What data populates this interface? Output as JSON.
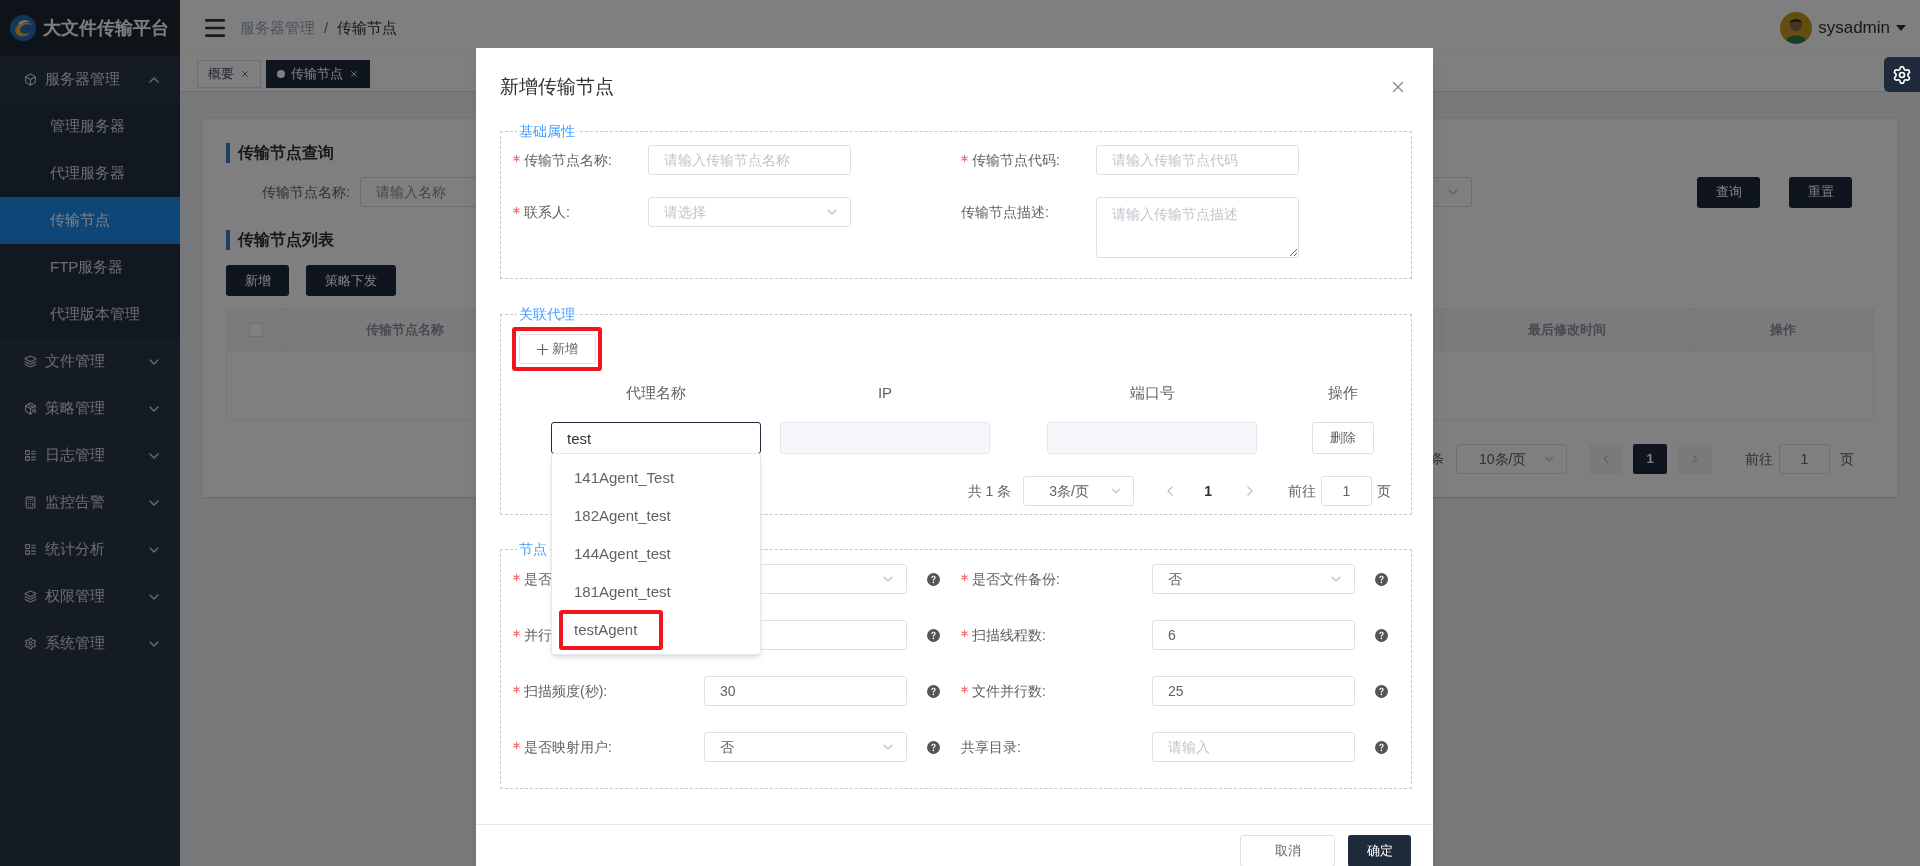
{
  "header": {
    "app_title": "大文件传输平台",
    "breadcrumb": [
      "服务器管理",
      "传输节点"
    ],
    "breadcrumb_separator": "/",
    "user": "sysadmin"
  },
  "sidebar": {
    "items": [
      {
        "label": "服务器管理",
        "expanded": true,
        "children": [
          {
            "label": "管理服务器",
            "selected": false
          },
          {
            "label": "代理服务器",
            "selected": false
          },
          {
            "label": "传输节点",
            "selected": true
          },
          {
            "label": "FTP服务器",
            "selected": false
          },
          {
            "label": "代理版本管理",
            "selected": false
          }
        ]
      },
      {
        "label": "文件管理",
        "expanded": false
      },
      {
        "label": "策略管理",
        "expanded": false
      },
      {
        "label": "日志管理",
        "expanded": false
      },
      {
        "label": "监控告警",
        "expanded": false
      },
      {
        "label": "统计分析",
        "expanded": false
      },
      {
        "label": "权限管理",
        "expanded": false
      },
      {
        "label": "系统管理",
        "expanded": false
      }
    ]
  },
  "tabs": [
    {
      "label": "概要",
      "selected": false
    },
    {
      "label": "传输节点",
      "selected": true
    }
  ],
  "page": {
    "query_title": "传输节点查询",
    "filter": {
      "label": "传输节点名称:",
      "placeholder": "请输入名称"
    },
    "buttons": [
      "查询",
      "重置"
    ],
    "list_title": "传输节点列表",
    "list_buttons": [
      "新增",
      "策略下发"
    ],
    "table": {
      "select_all": {
        "checked": false
      },
      "columns": [
        "传输节点名称",
        "最后修改时间",
        "操作"
      ]
    },
    "pagination": {
      "total_tail": "条",
      "page_size": "10条/页",
      "pages": [
        {
          "label": "1",
          "selected": true
        }
      ],
      "goto_label": "前往",
      "goto_value": "1",
      "goto_suffix": "页"
    }
  },
  "dialog": {
    "title": "新增传输节点",
    "basic": {
      "legend": "基础属性",
      "fields": [
        {
          "label": "传输节点名称:",
          "required": true,
          "kind": "input",
          "placeholder": "请输入传输节点名称"
        },
        {
          "label": "传输节点代码:",
          "required": true,
          "kind": "input",
          "placeholder": "请输入传输节点代码"
        },
        {
          "label": "联系人:",
          "required": true,
          "kind": "select",
          "placeholder": "请选择"
        },
        {
          "label": "传输节点描述:",
          "required": false,
          "kind": "textarea",
          "placeholder": "请输入传输节点描述"
        }
      ]
    },
    "agents": {
      "legend": "关联代理",
      "add_button": {
        "label": "新增",
        "highlighted": true
      },
      "columns": [
        "代理名称",
        "IP",
        "端口号",
        "操作"
      ],
      "rows": [
        {
          "name": "test",
          "delete": "删除"
        }
      ],
      "suggestions": [
        {
          "label": "141Agent_Test",
          "highlighted": false
        },
        {
          "label": "182Agent_test",
          "highlighted": false
        },
        {
          "label": "144Agent_test",
          "highlighted": false
        },
        {
          "label": "181Agent_test",
          "highlighted": false
        },
        {
          "label": "testAgent",
          "highlighted": true
        }
      ],
      "pagination": {
        "total": "共 1 条",
        "page_size": "3条/页",
        "page": "1",
        "goto_label": "前往",
        "goto_value": "1",
        "goto_suffix": "页"
      }
    },
    "config": {
      "legend": "节点",
      "fields": [
        {
          "label": "是否",
          "required": true,
          "kind": "select"
        },
        {
          "label": "是否文件备份:",
          "required": true,
          "kind": "select",
          "value": "否"
        },
        {
          "label": "并行",
          "required": true,
          "kind": "input"
        },
        {
          "label": "扫描线程数:",
          "required": true,
          "kind": "input",
          "value": "6"
        },
        {
          "label": "扫描频度(秒):",
          "required": true,
          "kind": "input",
          "value": "30"
        },
        {
          "label": "文件并行数:",
          "required": true,
          "kind": "input",
          "value": "25"
        },
        {
          "label": "是否映射用户:",
          "required": true,
          "kind": "select",
          "value": "否"
        },
        {
          "label": "共享目录:",
          "required": false,
          "kind": "input",
          "placeholder": "请输入"
        }
      ]
    },
    "footer_buttons": [
      {
        "label": "取消",
        "kind": "secondary"
      },
      {
        "label": "确定",
        "kind": "primary"
      }
    ]
  }
}
